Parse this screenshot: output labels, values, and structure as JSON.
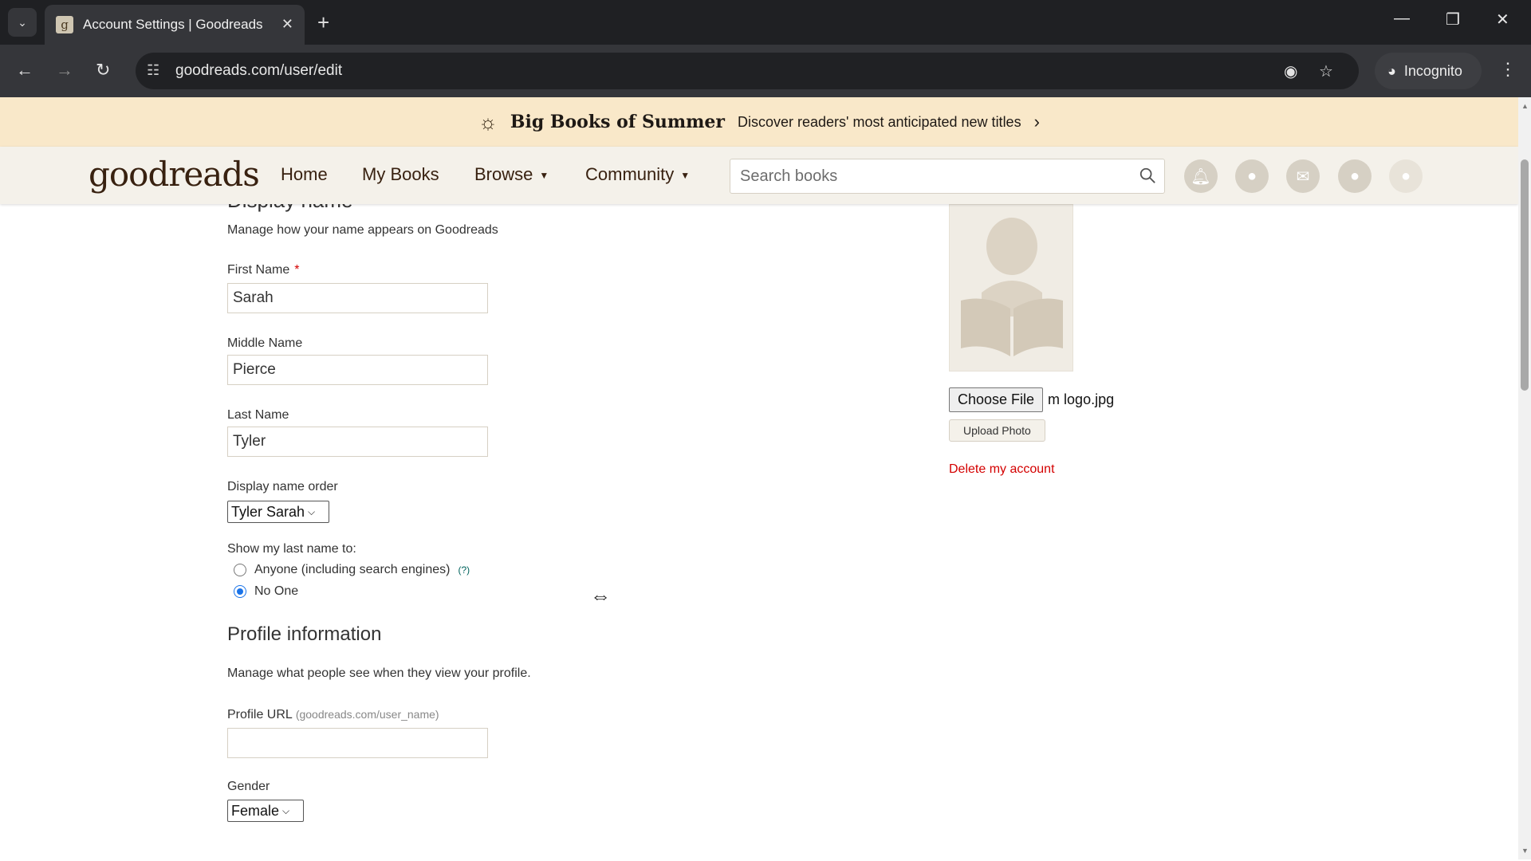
{
  "browser": {
    "tab_title": "Account Settings | Goodreads",
    "tab_favicon": "g",
    "url": "goodreads.com/user/edit",
    "incognito_label": "Incognito"
  },
  "banner": {
    "title": "Big Books of Summer",
    "subtitle": "Discover readers' most anticipated new titles"
  },
  "header": {
    "logo": "goodreads",
    "nav": [
      "Home",
      "My Books",
      "Browse",
      "Community"
    ],
    "search_placeholder": "Search books"
  },
  "display_name": {
    "section_title": "Display name",
    "description": "Manage how your name appears on Goodreads",
    "first_name_label": "First Name",
    "required_mark": "*",
    "first_name": "Sarah",
    "middle_name_label": "Middle Name",
    "middle_name": "Pierce",
    "last_name_label": "Last Name",
    "last_name": "Tyler",
    "order_label": "Display name order",
    "order_value": "Tyler Sarah",
    "show_last_label": "Show my last name to:",
    "option_anyone": "Anyone (including search engines)",
    "help_link": "(?)",
    "option_noone": "No One"
  },
  "profile": {
    "section_title": "Profile information",
    "description": "Manage what people see when they view your profile.",
    "url_label": "Profile URL",
    "url_hint": "(goodreads.com/user_name)",
    "url_value": "",
    "gender_label": "Gender",
    "gender_value": "Female"
  },
  "photo": {
    "choose_label": "Choose File",
    "file_name": "m logo.jpg",
    "upload_label": "Upload Photo",
    "delete_label": "Delete my account"
  }
}
